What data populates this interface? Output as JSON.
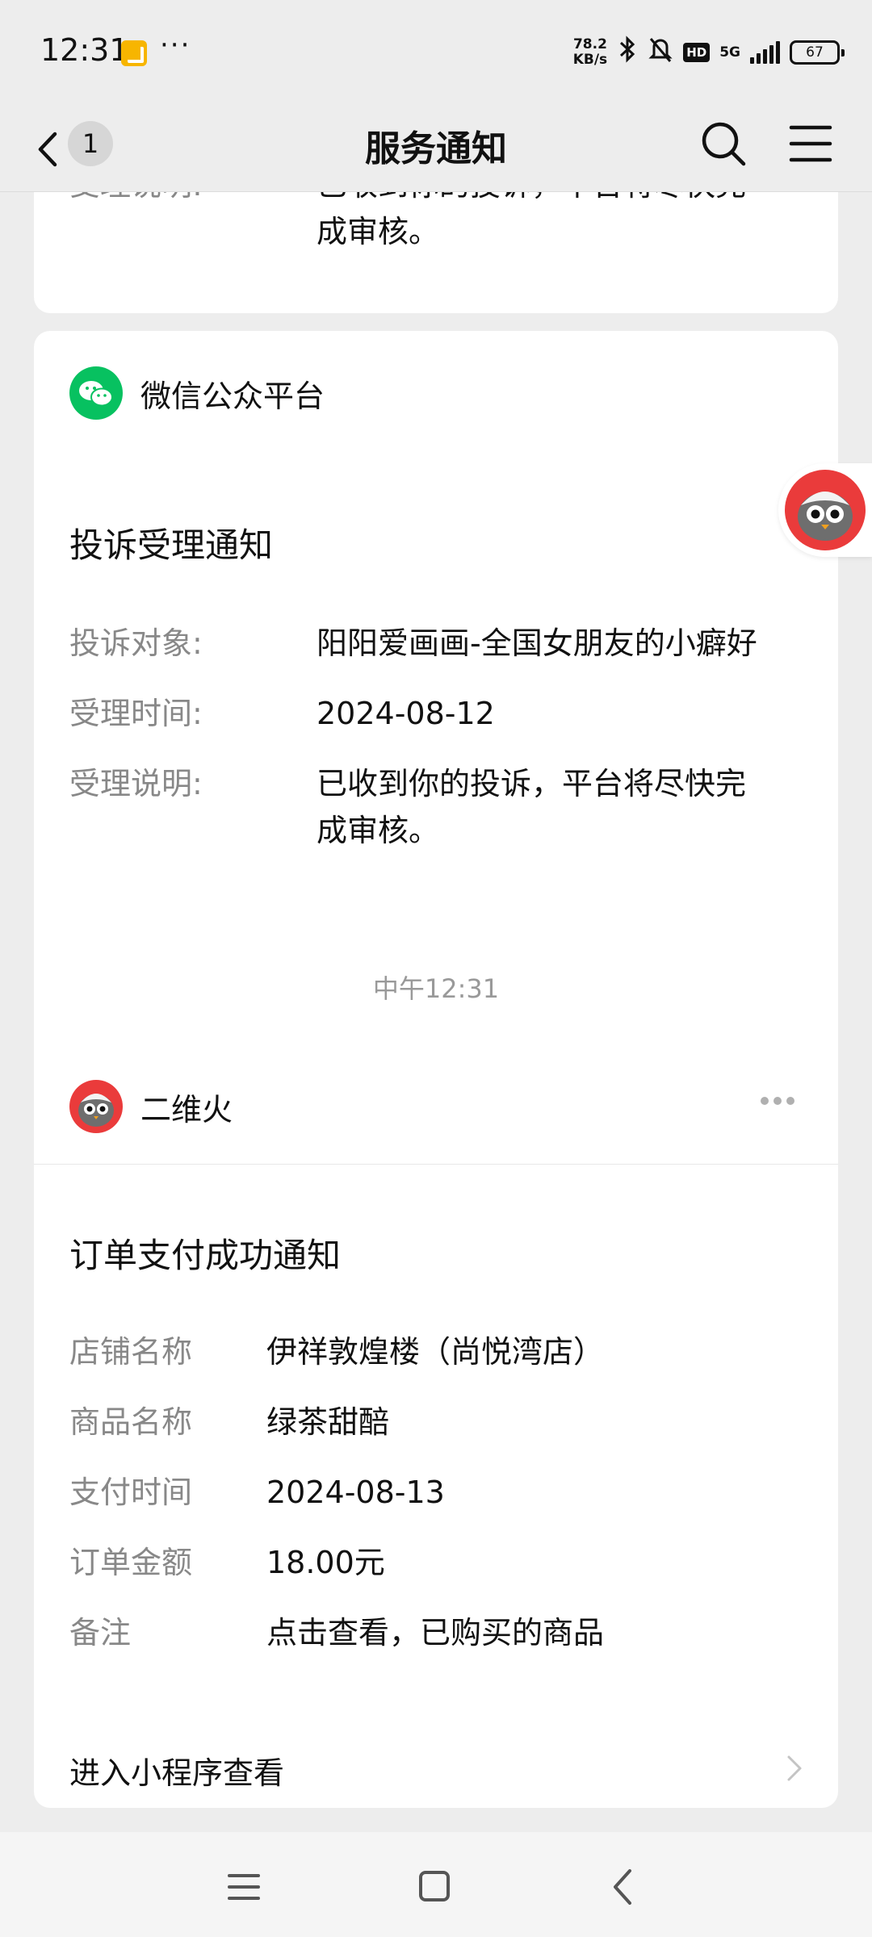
{
  "status_bar": {
    "time": "12:31",
    "more": "···",
    "net_speed_value": "78.2",
    "net_speed_unit": "KB/s",
    "network": "5G",
    "hd": "HD",
    "battery": "67"
  },
  "header": {
    "title": "服务通知",
    "unread_count": "1"
  },
  "top_card": {
    "label": "受理说明:",
    "value": "已收到你的投诉，平台将尽快完",
    "value_line2": "成审核。"
  },
  "card_wechat": {
    "sender": "微信公众平台",
    "title": "投诉受理通知",
    "rows": [
      {
        "label": "投诉对象:",
        "value": "阳阳爱画画-全国女朋友的小癖好"
      },
      {
        "label": "受理时间:",
        "value": "2024-08-12"
      },
      {
        "label": "受理说明:",
        "value": "已收到你的投诉，平台将尽快完",
        "value_line2": "成审核。"
      }
    ]
  },
  "time_separator": "中午12:31",
  "card_order": {
    "sender": "二维火",
    "title": "订单支付成功通知",
    "rows": [
      {
        "label": "店铺名称",
        "value": "伊祥敦煌楼（尚悦湾店）"
      },
      {
        "label": "商品名称",
        "value": "绿茶甜醅"
      },
      {
        "label": "支付时间",
        "value": "2024-08-13"
      },
      {
        "label": "订单金额",
        "value": "18.00元"
      },
      {
        "label": "备注",
        "value": "点击查看，已购买的商品"
      }
    ],
    "footer_link": "进入小程序查看"
  },
  "colors": {
    "background": "#ededed",
    "card": "#ffffff",
    "wechat_green": "#07c160",
    "owl_red": "#ea3b3b",
    "label_gray": "#888888"
  }
}
